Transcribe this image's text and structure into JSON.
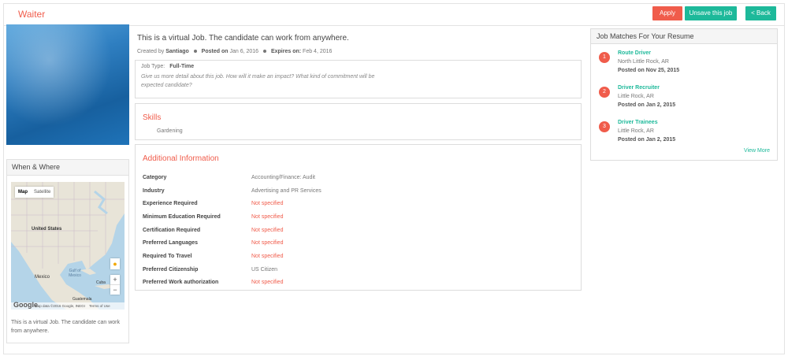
{
  "header": {
    "title": "Waiter",
    "apply_label": "Apply",
    "unsave_label": "Unsave this job",
    "back_label": "< Back"
  },
  "when_where": {
    "heading": "When & Where",
    "map_tab_map": "Map",
    "map_tab_satellite": "Satellite",
    "map_labels": {
      "united_states": "United States",
      "mexico": "Mexico",
      "gulf": "Gulf of Mexico",
      "cuba": "Cuba",
      "guatemala": "Guatemala"
    },
    "map_logo": "Google",
    "map_attribution": "Map data ©2016 Google, INEGI",
    "map_terms": "Terms of Use",
    "zoom_in": "+",
    "zoom_out": "−",
    "description": "This is a virtual Job. The candidate can work from anywhere."
  },
  "job": {
    "headline": "This is a virtual Job. The candidate can work from anywhere.",
    "created_by_label": "Created by",
    "created_by": "Santiago",
    "posted_label": "Posted on",
    "posted_date": "Jan 6, 2016",
    "expires_label": "Expires on:",
    "expires_date": "Feb 4, 2016",
    "job_type_label": "Job Type:",
    "job_type": "Full-Time",
    "description": "Give us more detail about this job. How will it make an impact? What kind of commitment will be expected candidate?"
  },
  "skills": {
    "heading": "Skills",
    "items": [
      "Gardening"
    ]
  },
  "additional_info": {
    "heading": "Additional Information",
    "rows": [
      {
        "label": "Category",
        "value": "Accounting/Finance:  Audit"
      },
      {
        "label": "Industry",
        "value": "Advertising and PR Services"
      },
      {
        "label": "Experience Required",
        "value": "Not specified"
      },
      {
        "label": "Minimum Education Required",
        "value": "Not specified"
      },
      {
        "label": "Certification Required",
        "value": "Not specified"
      },
      {
        "label": "Preferred Languages",
        "value": "Not specified"
      },
      {
        "label": "Required To Travel",
        "value": "Not specified"
      },
      {
        "label": "Preferred Citizenship",
        "value": "US Citizen"
      },
      {
        "label": "Preferred Work authorization",
        "value": "Not specified"
      }
    ]
  },
  "job_matches": {
    "heading": "Job Matches For Your Resume",
    "items": [
      {
        "num": "1",
        "title": "Route Driver",
        "location": "North Little Rock, AR",
        "date": "Posted on Nov 25, 2015"
      },
      {
        "num": "2",
        "title": "Driver Recruiter",
        "location": "Little Rock, AR",
        "date": "Posted on Jan 2, 2015"
      },
      {
        "num": "3",
        "title": "Driver Trainees",
        "location": "Little Rock, AR",
        "date": "Posted on Jan 2, 2015"
      }
    ],
    "view_more": "View More"
  },
  "colors": {
    "accent_red": "#f05c4b",
    "accent_teal": "#1db99a"
  }
}
